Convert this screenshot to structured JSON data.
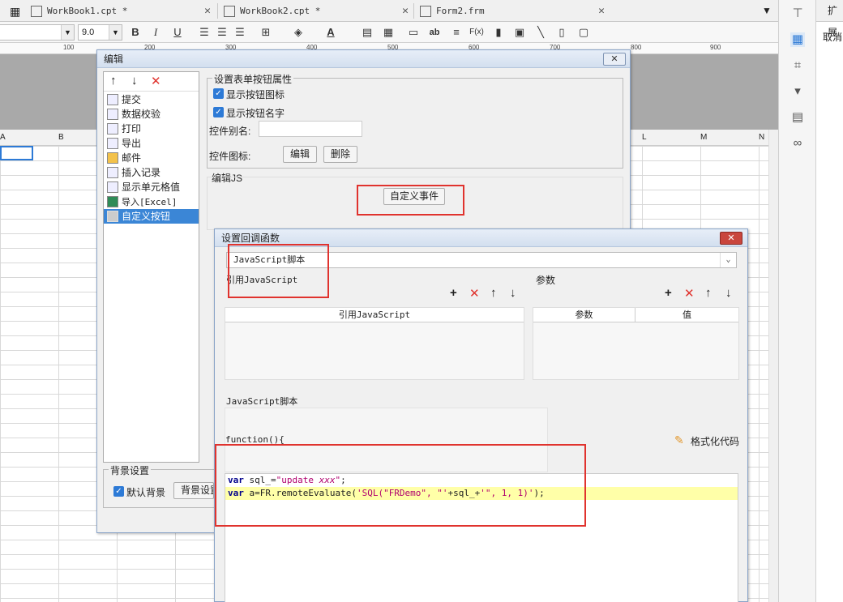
{
  "tabs": [
    {
      "label": "WorkBook1.cpt *"
    },
    {
      "label": "WorkBook2.cpt *"
    },
    {
      "label": "Form2.frm"
    }
  ],
  "toolbar": {
    "font_size": "9.0",
    "bold": "B",
    "italic": "I",
    "underline": "U",
    "text_style": "ab",
    "formula": "F(x)"
  },
  "ruler": {
    "marks": [
      "100",
      "200",
      "300",
      "400",
      "500",
      "600",
      "700",
      "800",
      "900"
    ]
  },
  "columns": [
    "A",
    "B",
    "L",
    "M",
    "N"
  ],
  "ext_panel": {
    "header": "扩展",
    "cancel": "取消"
  },
  "dialog1": {
    "title": "编辑",
    "tree_items": [
      "提交",
      "数据校验",
      "打印",
      "导出",
      "邮件",
      "插入记录",
      "显示单元格值",
      "导入[Excel]",
      "自定义按钮"
    ],
    "selected_item": "自定义按钮",
    "props_group": "设置表单按钮属性",
    "show_icon": "显示按钮图标",
    "show_name": "显示按钮名字",
    "alias_label": "控件别名:",
    "icon_label": "控件图标:",
    "edit_btn": "编辑",
    "delete_btn": "删除",
    "js_group": "编辑JS",
    "custom_event_btn": "自定义事件",
    "bg_group": "背景设置",
    "default_bg": "默认背景",
    "bg_settings": "背景设置"
  },
  "dialog2": {
    "title": "设置回调函数",
    "type_selected": "JavaScript脚本",
    "ref_js_label": "引用JavaScript",
    "params_label": "参数",
    "table1_header": "引用JavaScript",
    "table2_headers": [
      "参数",
      "值"
    ],
    "script_label": "JavaScript脚本",
    "function_line": "function(){",
    "format_code": "格式化代码",
    "code_lines": [
      "var sql_=\"update xxx\";",
      "var a=FR.remoteEvaluate('SQL(\"FRDemo\", \"'+sql_+'\", 1, 1)');"
    ]
  }
}
